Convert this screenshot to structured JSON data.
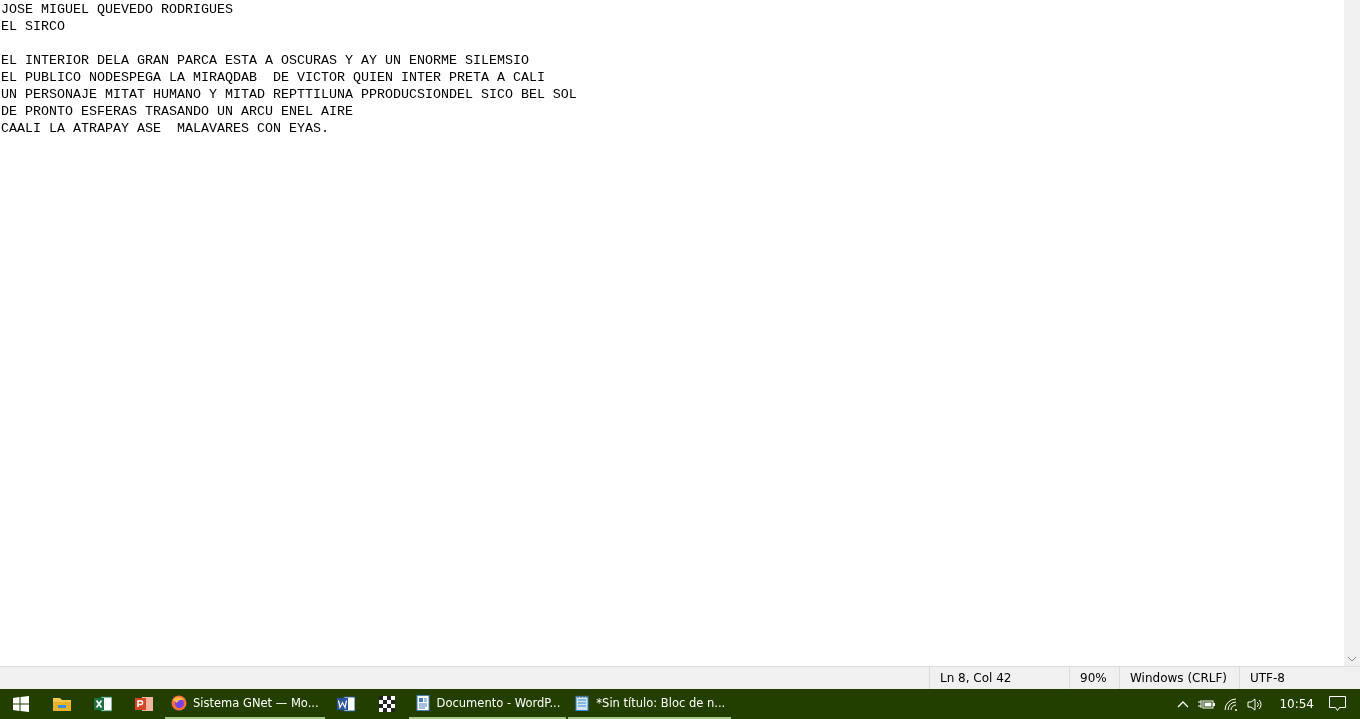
{
  "editor": {
    "header_lines": [
      "JOSE MIGUEL QUEVEDO RODRIGUES",
      "EL SIRCO"
    ],
    "body_lines": [
      "EL INTERIOR DELA GRAN PARCA ESTA A OSCURAS Y AY UN ENORME SILEMSIO",
      "EL PUBLICO NODESPEGA LA MIRAQDAB  DE VICTOR QUIEN INTER PRETA A CALI",
      "UN PERSONAJE MITAT HUMANO Y MITAD REPTTILUNA PPRODUCSIONDEL SICO BEL SOL",
      "DE PRONTO ESFERAS TRASANDO UN ARCU ENEL AIRE",
      "CAALI LA ATRAPAY ASE  MALAVARES CON EYAS."
    ]
  },
  "status_bar": [
    "Ln 8, Col 42",
    "90%",
    "Windows (CRLF)",
    "UTF-8"
  ],
  "taskbar": {
    "items": [
      {
        "kind": "start"
      },
      {
        "kind": "folder"
      },
      {
        "kind": "excel"
      },
      {
        "kind": "powerpoint"
      },
      {
        "kind": "firefox",
        "label": "Sistema GNet — Mo..."
      },
      {
        "kind": "word"
      },
      {
        "kind": "grid"
      },
      {
        "kind": "wordpad",
        "label": "Documento - WordP..."
      },
      {
        "kind": "notepad",
        "label": "*Sin título: Bloc de n..."
      }
    ],
    "clock": "10:54"
  }
}
